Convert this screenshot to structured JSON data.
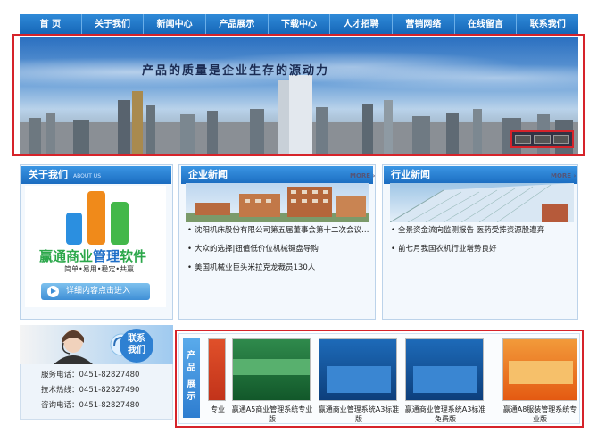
{
  "nav": [
    "首 页",
    "关于我们",
    "新闻中心",
    "产品展示",
    "下载中心",
    "人才招聘",
    "营销网络",
    "在线留言",
    "联系我们"
  ],
  "banner": {
    "slogan": "产品的质量是企业生存的源动力"
  },
  "about": {
    "title": "关于我们",
    "subtitle": "ABOUT US",
    "logo_text_green": "赢通商业",
    "logo_text_blue": "管理",
    "logo_text_green2": "软件",
    "logo_slogan": "简单•易用•稳定•共赢",
    "detail_button": "详细内容点击进入"
  },
  "company_news": {
    "title": "企业新闻",
    "more": "MORE ›",
    "items": [
      "沈阳机床股份有限公司第五届董事会第十二次会议…",
      "大众的选择|钮值低价位机械键盘导购",
      "美国机械业巨头米拉克龙裁员130人"
    ]
  },
  "industry_news": {
    "title": "行业新闻",
    "more": "MORE ›",
    "items": [
      "全景资金流向监测报告 医药受捧资源股遭弃",
      "前七月我国农机行业增势良好"
    ]
  },
  "contact": {
    "label_line1": "联系",
    "label_line2": "我们",
    "lines": [
      "服务电话：0451-82827480",
      "技术热线：0451-82827490",
      "咨询电话：0451-82827480"
    ]
  },
  "products": {
    "tab_line1": "产品",
    "tab_line2": "展示",
    "items": [
      {
        "label": "专业"
      },
      {
        "label": "赢通A5商业管理系统专业版"
      },
      {
        "label": "赢通商业管理系统A3标准版"
      },
      {
        "label": "赢通商业管理系统A3标准免费版"
      },
      {
        "label": "赢通A8服装管理系统专业版"
      }
    ]
  },
  "colors": {
    "nav": "#1f74c6",
    "accent_red": "#d6232a",
    "box_title": "#2a7fd3"
  }
}
